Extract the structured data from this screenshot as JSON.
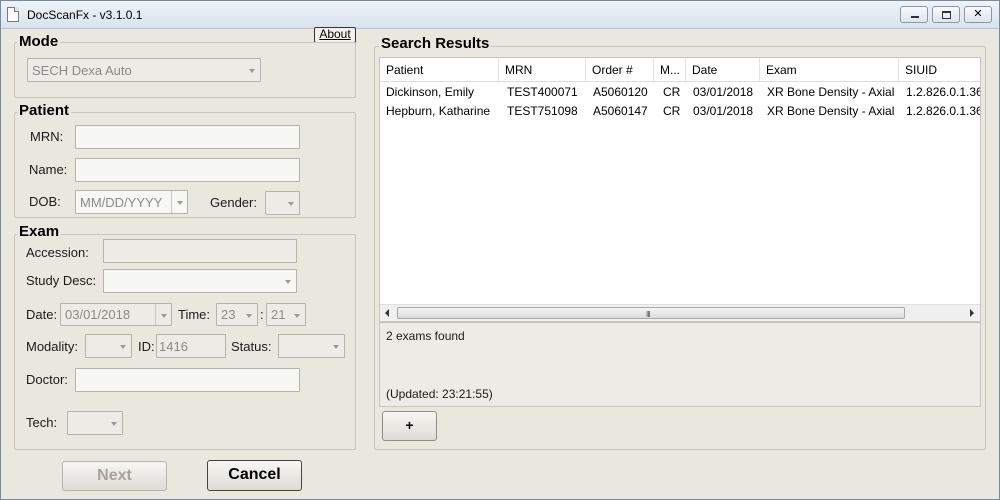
{
  "window": {
    "title": "DocScanFx  -  v3.1.0.1"
  },
  "about_label": "About",
  "mode": {
    "title": "Mode",
    "selected": "SECH Dexa Auto"
  },
  "patient": {
    "title": "Patient",
    "mrn_label": "MRN:",
    "mrn_value": "",
    "name_label": "Name:",
    "name_value": "",
    "dob_label": "DOB:",
    "dob_placeholder": "MM/DD/YYYY",
    "gender_label": "Gender:",
    "gender_value": ""
  },
  "exam": {
    "title": "Exam",
    "accession_label": "Accession:",
    "accession_value": "",
    "study_desc_label": "Study Desc:",
    "study_desc_value": "",
    "date_label": "Date:",
    "date_value": "03/01/2018",
    "time_label": "Time:",
    "time_hour": "23",
    "time_sep": ":",
    "time_minute": "21",
    "modality_label": "Modality:",
    "modality_value": "",
    "id_label": "ID:",
    "id_value": "1416",
    "status_label": "Status:",
    "status_value": "",
    "doctor_label": "Doctor:",
    "doctor_value": "",
    "tech_label": "Tech:",
    "tech_value": ""
  },
  "buttons": {
    "next": "Next",
    "cancel": "Cancel",
    "add": "+"
  },
  "results": {
    "title": "Search Results",
    "columns": [
      "Patient",
      "MRN",
      "Order #",
      "M...",
      "Date",
      "Exam",
      "SIUID"
    ],
    "rows": [
      [
        "Dickinson, Emily",
        "TEST400071",
        "A5060120",
        "CR",
        "03/01/2018",
        "XR Bone Density - Axial",
        "1.2.826.0.1.36"
      ],
      [
        "Hepburn, Katharine",
        "TEST751098",
        "A5060147",
        "CR",
        "03/01/2018",
        "XR Bone Density - Axial",
        "1.2.826.0.1.36"
      ]
    ],
    "scroll_grip": "III",
    "status_line": "2 exams found",
    "updated_line": "(Updated: 23:21:55)"
  }
}
